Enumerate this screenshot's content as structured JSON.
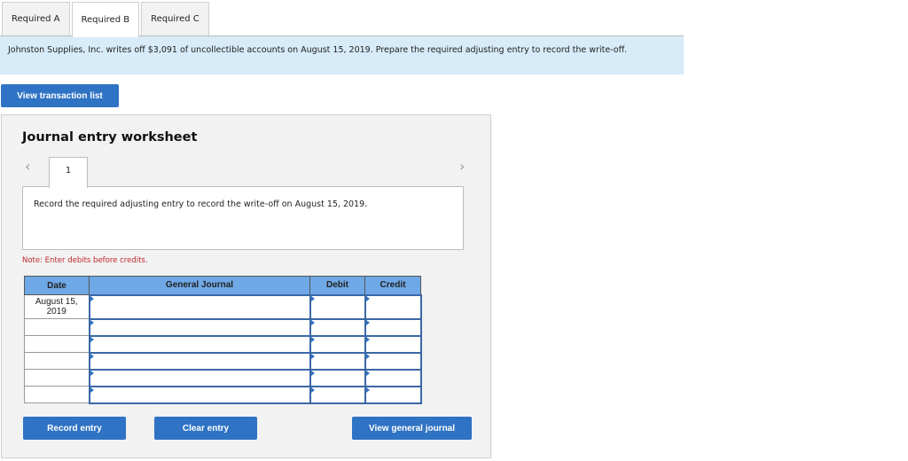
{
  "tabs": [
    {
      "label": "Required A",
      "active": false
    },
    {
      "label": "Required B",
      "active": true
    },
    {
      "label": "Required C",
      "active": false
    }
  ],
  "prompt": "Johnston Supplies, Inc. writes off $3,091 of uncollectible accounts on August 15, 2019. Prepare the required adjusting entry to record the write-off.",
  "view_transaction_list_label": "View transaction list",
  "worksheet": {
    "title": "Journal entry worksheet",
    "prev_icon": "‹",
    "next_icon": "›",
    "entry_number": "1",
    "entry_instruction": "Record the required adjusting entry to record the write-off on August 15, 2019.",
    "note": "Note: Enter debits before credits.",
    "table": {
      "headers": {
        "date": "Date",
        "general_journal": "General Journal",
        "debit": "Debit",
        "credit": "Credit"
      },
      "rows": [
        {
          "date": "August 15, 2019",
          "account": "",
          "debit": "",
          "credit": ""
        },
        {
          "date": "",
          "account": "",
          "debit": "",
          "credit": ""
        },
        {
          "date": "",
          "account": "",
          "debit": "",
          "credit": ""
        },
        {
          "date": "",
          "account": "",
          "debit": "",
          "credit": ""
        },
        {
          "date": "",
          "account": "",
          "debit": "",
          "credit": ""
        },
        {
          "date": "",
          "account": "",
          "debit": "",
          "credit": ""
        }
      ]
    },
    "buttons": {
      "record": "Record entry",
      "clear": "Clear entry",
      "view_general_journal": "View general journal"
    }
  },
  "colors": {
    "accent_button": "#2f73c4",
    "header_blue": "#6fa8e6",
    "prompt_bg": "#d7ebf8",
    "note_red": "#c0272d"
  }
}
